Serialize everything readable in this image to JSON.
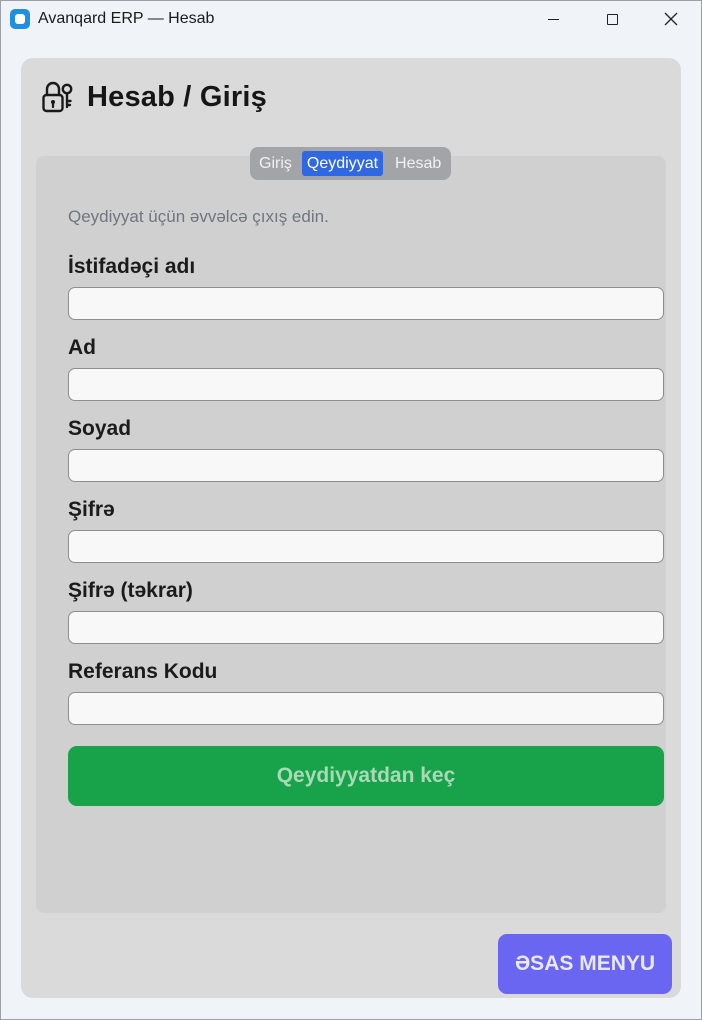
{
  "window": {
    "title": "Avanqard ERP — Hesab",
    "controls": [
      "minimize-icon",
      "maximize-icon",
      "close-icon"
    ]
  },
  "page": {
    "title": "Hesab / Giriş",
    "title_icon": "lock-user-icon"
  },
  "tabs": [
    {
      "label": "Giriş",
      "active": false
    },
    {
      "label": "Qeydiyyat",
      "active": true
    },
    {
      "label": "Hesab",
      "active": false
    }
  ],
  "form": {
    "hint": "Qeydiyyat üçün əvvəlcə çıxış edin.",
    "fields": [
      {
        "label": "İstifadəçi adı",
        "value": "",
        "placeholder": ""
      },
      {
        "label": "Ad",
        "value": "",
        "placeholder": ""
      },
      {
        "label": "Soyad",
        "value": "",
        "placeholder": ""
      },
      {
        "label": "Şifrə",
        "value": "",
        "placeholder": ""
      },
      {
        "label": "Şifrə (təkrar)",
        "value": "",
        "placeholder": ""
      },
      {
        "label": "Referans Kodu",
        "value": "",
        "placeholder": ""
      }
    ],
    "submit_label": "Qeydiyyatdan keç"
  },
  "main_menu_label": "ƏSAS MENYU",
  "colors": {
    "tab_active": "#2f68e0",
    "submit": "#18a34a",
    "main_menu": "#6a66f2",
    "panel": "#dadada",
    "card": "#d0d0d0"
  }
}
